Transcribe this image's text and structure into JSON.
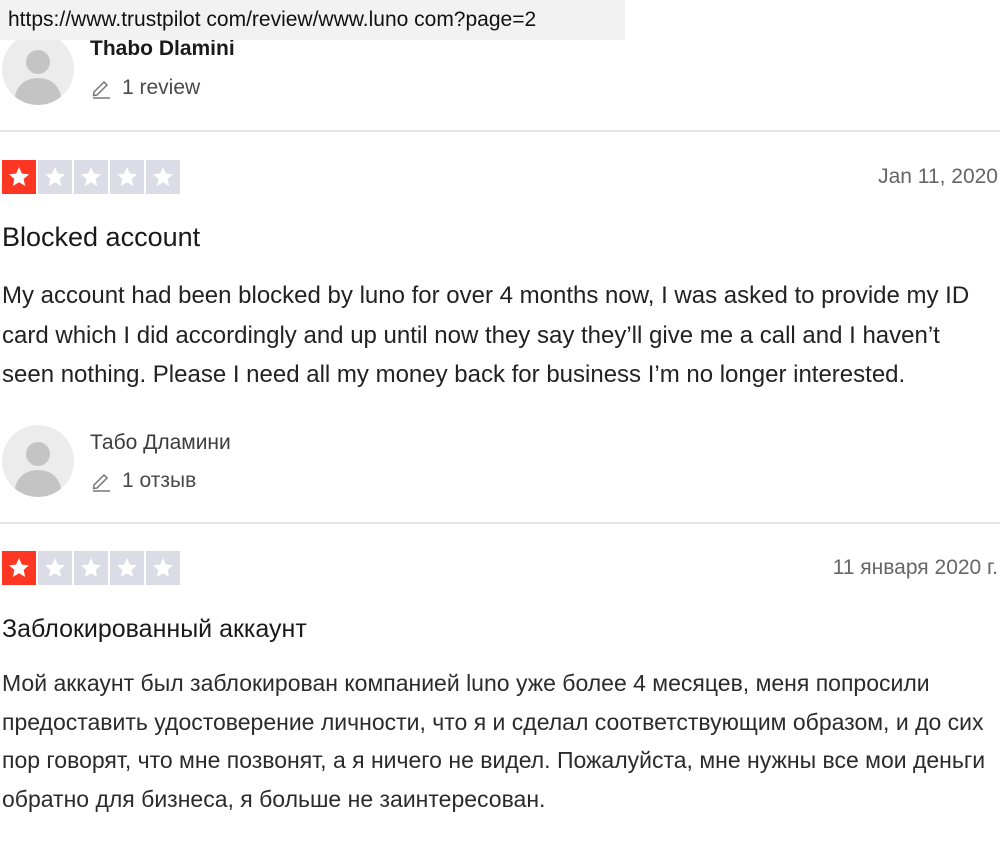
{
  "browser": {
    "url": "https://www.trustpilot com/review/www.luno com?page=2"
  },
  "reviews": [
    {
      "reviewer_name": "Thabo Dlamini",
      "review_count": "1 review",
      "rating": 1,
      "date": "Jan 11, 2020",
      "title": "Blocked account",
      "body": "My account had been blocked by luno for over 4 months now, I was asked to provide my ID card which I did accordingly and up until now they say they’ll give me a call and I haven’t seen nothing. Please I need all my money back for business I’m no longer interested."
    },
    {
      "reviewer_name": "Табо Дламини",
      "review_count": "1 отзыв",
      "rating": 1,
      "date": "11 января 2020 г.",
      "title": "Заблокированный аккаунт",
      "body": "Мой аккаунт был заблокирован компанией luno уже более 4 месяцев, меня попросили предоставить удостоверение личности, что я и сделал соответствующим образом, и до сих пор говорят, что мне позвонят, а я ничего не видел. Пожалуйста, мне нужны все мои деньги обратно для бизнеса, я больше не заинтересован."
    }
  ],
  "colors": {
    "star_active": "#ff3722",
    "star_inactive": "#dcdce6",
    "divider": "#e5e5e5"
  },
  "icons": {
    "avatar": "user-silhouette-icon",
    "count": "pencil-icon",
    "star": "star-icon"
  }
}
